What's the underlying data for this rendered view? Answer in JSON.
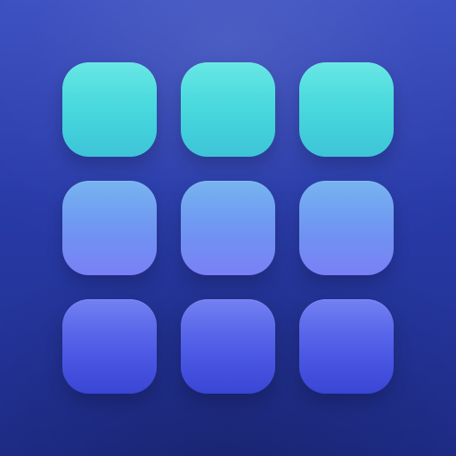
{
  "icon": {
    "name": "grid-app-icon",
    "colors": {
      "background_top": "#3b4fc0",
      "background_bottom": "#1f2d8b",
      "row_1": "#45d6dc",
      "row_2": "#6f93f2",
      "row_3": "#4b58e4"
    },
    "grid": {
      "rows": 3,
      "cols": 3
    }
  }
}
